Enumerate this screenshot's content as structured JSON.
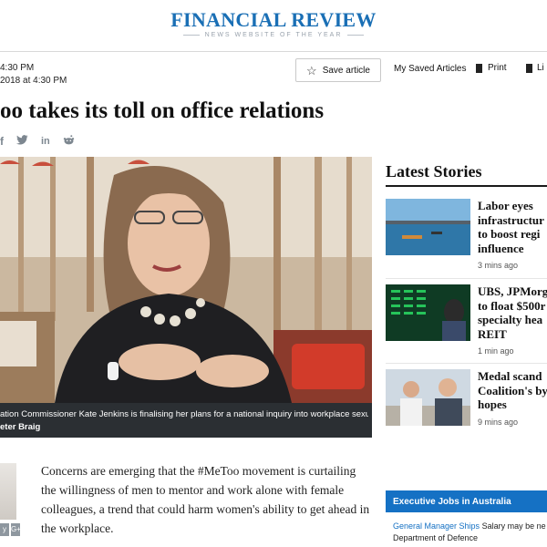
{
  "header": {
    "brand": "FINANCIAL REVIEW",
    "tagline": "NEWS WEBSITE OF THE YEAR",
    "brand_color": "#1a6fb5"
  },
  "meta": {
    "time_1": "4:30 PM",
    "time_2": "2018 at 4:30 PM"
  },
  "toolbar": {
    "save_label": "Save article",
    "my_saved_label": "My Saved Articles",
    "print_label": "Print",
    "li_label": "Li"
  },
  "article": {
    "headline": "oo takes its toll on office relations",
    "caption_line1": "ation Commissioner Kate Jenkins is finalising her plans for a national inquiry into workplace sexual",
    "caption_line2": "eter Braig",
    "lede": "Concerns are emerging that the #MeToo movement is curtailing the willingness of men to mentor and work alone with female colleagues, a trend that could harm women's ability to get ahead in the workplace."
  },
  "share": {
    "facebook": "f",
    "twitter": "🐦",
    "linkedin": "in",
    "reddit": "👽"
  },
  "sidebar": {
    "latest_title": "Latest Stories",
    "stories": [
      {
        "title_lines": [
          "Labor eyes",
          "infrastructur",
          "to boost regi",
          "influence"
        ],
        "time": "3 mins ago"
      },
      {
        "title_lines": [
          "UBS, JPMorg",
          "to float $500r",
          "specialty hea",
          "REIT"
        ],
        "time": "1 min ago"
      },
      {
        "title_lines": [
          "Medal scand",
          "Coalition's by",
          "hopes"
        ],
        "time": "9 mins ago"
      }
    ],
    "jobs_title": "Executive Jobs in Australia",
    "job_link": "General Manager Ships",
    "job_salary": "Salary may be ne",
    "job_org": "Department of Defence"
  },
  "author": {
    "social_1": "y",
    "social_2": "G+"
  }
}
